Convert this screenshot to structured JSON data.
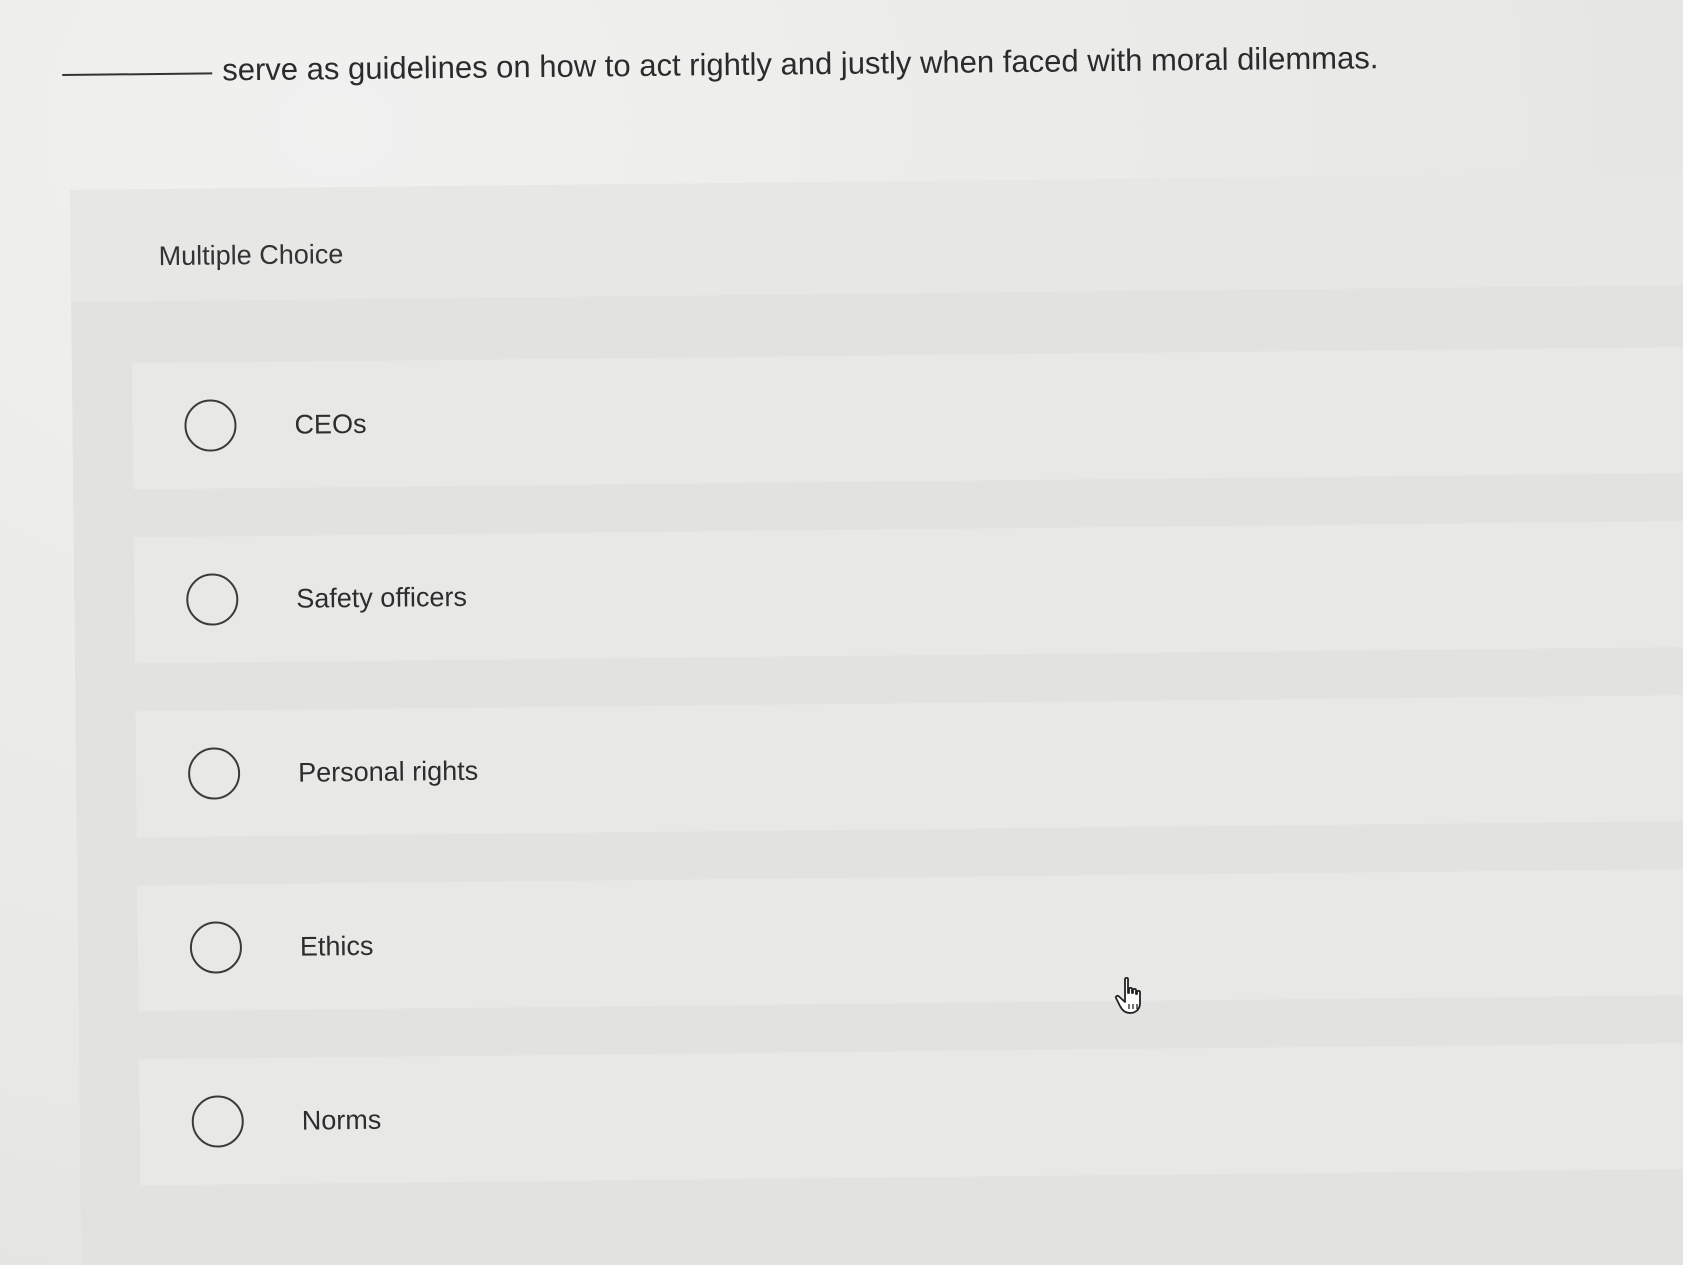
{
  "question": {
    "text": "serve as guidelines on how to act rightly and justly when faced with moral dilemmas."
  },
  "panel": {
    "type_label": "Multiple Choice"
  },
  "options": [
    {
      "label": "CEOs"
    },
    {
      "label": "Safety officers"
    },
    {
      "label": "Personal rights"
    },
    {
      "label": "Ethics"
    },
    {
      "label": "Norms"
    }
  ],
  "icons": {
    "cursor": "hand-pointer-icon",
    "radio": "radio-unchecked-icon"
  }
}
